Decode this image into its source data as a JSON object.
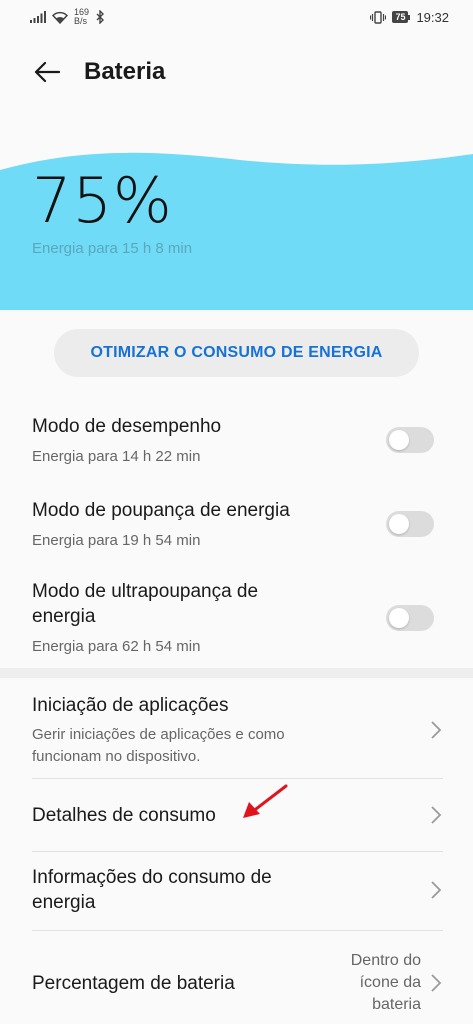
{
  "status_bar": {
    "speed_value": "169",
    "speed_unit": "B/s",
    "battery_level": "75",
    "time": "19:32"
  },
  "header": {
    "title": "Bateria"
  },
  "hero": {
    "percent": "75%",
    "remaining": "Energia para 15 h 8 min",
    "wave_color": "#6fdbf6"
  },
  "optimize_button": {
    "label": "OTIMIZAR O CONSUMO DE ENERGIA"
  },
  "modes": [
    {
      "title": "Modo de desempenho",
      "subtitle": "Energia para 14 h 22 min",
      "enabled": false
    },
    {
      "title": "Modo de poupança de energia",
      "subtitle": "Energia para 19 h 54 min",
      "enabled": false
    },
    {
      "title_line1": "Modo de ultrapoupança de",
      "title_line2": "energia",
      "subtitle": "Energia para 62 h 54 min",
      "enabled": false
    }
  ],
  "settings": [
    {
      "title": "Iniciação de aplicações",
      "subtitle_line1": "Gerir iniciações de aplicações e como",
      "subtitle_line2": "funcionam no dispositivo."
    },
    {
      "title": "Detalhes de consumo"
    },
    {
      "title_line1": "Informações do consumo de",
      "title_line2": "energia"
    },
    {
      "title": "Percentagem de bateria",
      "value_line1": "Dentro do",
      "value_line2": "ícone da",
      "value_line3": "bateria"
    }
  ],
  "colors": {
    "accent": "#1672d6",
    "annotation_arrow": "#e0141e"
  }
}
